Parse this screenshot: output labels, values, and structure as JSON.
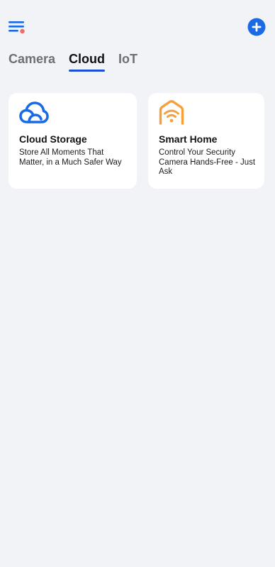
{
  "header": {
    "menu_icon": "menu-lines-icon",
    "notification_dot_color": "#f26b6b",
    "add_icon": "plus-circle-icon",
    "accent_color": "#1a6ae6"
  },
  "tabs": [
    {
      "label": "Camera",
      "active": false
    },
    {
      "label": "Cloud",
      "active": true
    },
    {
      "label": "IoT",
      "active": false
    }
  ],
  "cards": [
    {
      "icon": "cloud-icon",
      "icon_color": "#1a6ae6",
      "title": "Cloud Storage",
      "description": "Store All Moments That Matter, in a Much Safer Way"
    },
    {
      "icon": "smart-home-wifi-icon",
      "icon_color": "#f5a03a",
      "title": "Smart Home",
      "description": "Control Your Security Camera Hands-Free - Just Ask"
    }
  ]
}
